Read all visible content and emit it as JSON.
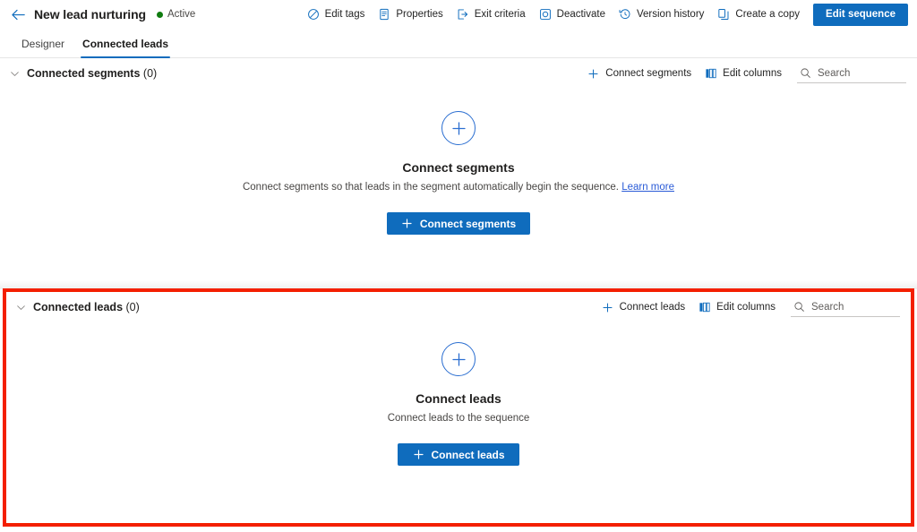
{
  "header": {
    "back_icon": "arrow-left-icon",
    "title": "New lead nurturing",
    "status_label": "Active",
    "status_color": "#107c10",
    "commands": [
      {
        "id": "edit-tags",
        "label": "Edit tags",
        "icon": "tag-icon"
      },
      {
        "id": "properties",
        "label": "Properties",
        "icon": "document-properties-icon"
      },
      {
        "id": "exit-criteria",
        "label": "Exit criteria",
        "icon": "exit-icon"
      },
      {
        "id": "deactivate",
        "label": "Deactivate",
        "icon": "deactivate-circle-icon"
      },
      {
        "id": "version-history",
        "label": "Version history",
        "icon": "history-clock-icon"
      },
      {
        "id": "create-a-copy",
        "label": "Create a copy",
        "icon": "copy-icon"
      }
    ],
    "primary_button": {
      "label": "Edit sequence",
      "color": "#0f6cbd"
    }
  },
  "tabs": [
    {
      "id": "designer",
      "label": "Designer",
      "active": false
    },
    {
      "id": "connected-leads",
      "label": "Connected leads",
      "active": true
    }
  ],
  "segments_section": {
    "chevron_icon": "chevron-down-icon",
    "title": "Connected segments",
    "count": "(0)",
    "actions": [
      {
        "id": "connect-segments",
        "label": "Connect segments",
        "icon": "plus-icon"
      },
      {
        "id": "edit-columns",
        "label": "Edit columns",
        "icon": "edit-columns-icon"
      }
    ],
    "search": {
      "placeholder": "Search",
      "value": "",
      "icon": "search-icon"
    },
    "empty": {
      "icon": "plus-circle-icon",
      "title": "Connect segments",
      "description": "Connect segments so that leads in the segment automatically begin the sequence.",
      "link_label": "Learn more",
      "button_label": "Connect segments",
      "button_icon": "plus-icon"
    }
  },
  "leads_section": {
    "chevron_icon": "chevron-down-icon",
    "title": "Connected leads",
    "count": "(0)",
    "actions": [
      {
        "id": "connect-leads",
        "label": "Connect leads",
        "icon": "plus-icon"
      },
      {
        "id": "edit-columns",
        "label": "Edit columns",
        "icon": "edit-columns-icon"
      }
    ],
    "search": {
      "placeholder": "Search",
      "value": "",
      "icon": "search-icon"
    },
    "empty": {
      "icon": "plus-circle-icon",
      "title": "Connect leads",
      "description": "Connect leads to the sequence",
      "button_label": "Connect leads",
      "button_icon": "plus-icon"
    },
    "highlight_color": "#f41f00"
  }
}
